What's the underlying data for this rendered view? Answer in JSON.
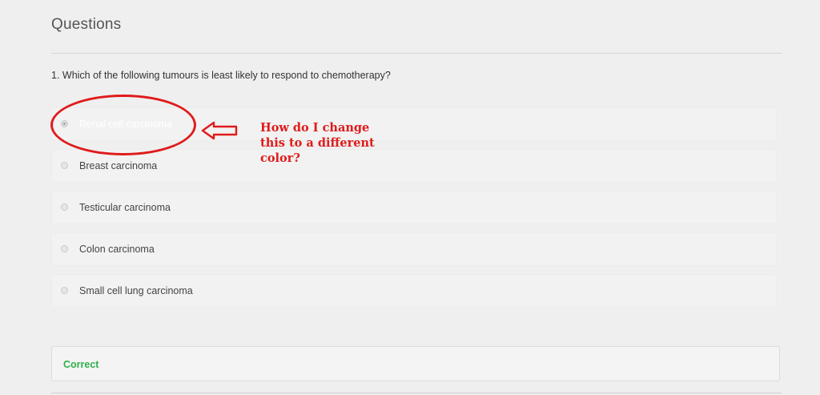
{
  "section": {
    "title": "Questions"
  },
  "question": {
    "text": "1. Which of the following tumours is least likely to respond to chemotherapy?"
  },
  "options": [
    {
      "label": "Renal cell carcinoma",
      "selected": true
    },
    {
      "label": "Breast carcinoma",
      "selected": false
    },
    {
      "label": "Testicular carcinoma",
      "selected": false
    },
    {
      "label": "Colon carcinoma",
      "selected": false
    },
    {
      "label": "Small cell lung carcinoma",
      "selected": false
    }
  ],
  "annotation": {
    "line1": "How do I change",
    "line2": "this to a different",
    "line3": "color?",
    "color": "#e01b1b"
  },
  "feedback": {
    "text": "Correct",
    "color": "#2fb14a"
  }
}
